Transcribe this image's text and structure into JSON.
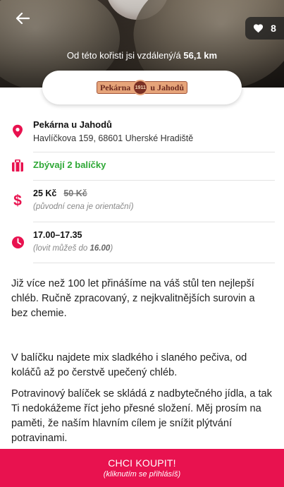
{
  "hero": {
    "favorite_count": "8",
    "distance_prefix": "Od této kořisti jsi vzdálený/á",
    "distance_value": "56,1 km"
  },
  "logo": {
    "text_left": "Pekárna",
    "badge": "1911",
    "text_right": "u Jahodů"
  },
  "shop": {
    "name": "Pekárna u Jahodů",
    "address": "Havlíčkova 159, 68601 Uherské Hradiště"
  },
  "packages": {
    "remaining": "Zbývají 2 balíčky"
  },
  "price": {
    "current": "25 Kč",
    "original": "50 Kč",
    "note": "(původní cena je orientační)"
  },
  "pickup": {
    "time": "17.00–17.35",
    "note_prefix": "(lovit můžeš do ",
    "note_time": "16.00",
    "note_suffix": ")"
  },
  "description": {
    "p1": "Již více než 100 let přinášíme na váš stůl ten nejlepší chléb. Ručně zpracovaný, z nejkvalitnějších surovin a bez chemie.",
    "p2": "V balíčku najdete mix sladkého i slaného pečiva, od koláčů až po čerstvě upečený chléb.",
    "p3": "Potravinový balíček se skládá z nadbytečného jídla, a tak Ti nedokážeme říct jeho přesné složení. Měj prosím na paměti, že naším hlavním cílem je snížit plýtvání potravinami."
  },
  "buy_button": {
    "label": "CHCI KOUPIT!",
    "sublabel": "(kliknutím se přihlásíš)"
  },
  "colors": {
    "accent": "#e8124f",
    "available_green": "#2ea836"
  },
  "icons": {
    "back": "arrow-left-icon",
    "favorite": "heart-icon",
    "location": "map-pin-icon",
    "packages": "package-icon",
    "price": "dollar-icon",
    "time": "clock-icon"
  }
}
